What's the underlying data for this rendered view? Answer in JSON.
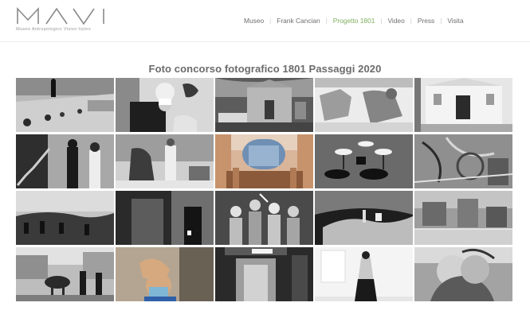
{
  "logo": {
    "brand": "MAVI",
    "subtitle": "Museo Antropologico Visivo Irpino"
  },
  "nav": {
    "items": [
      {
        "label": "Museo",
        "active": false
      },
      {
        "label": "Frank Cancian",
        "active": false
      },
      {
        "label": "Progetto 1801",
        "active": true
      },
      {
        "label": "Video",
        "active": false
      },
      {
        "label": "Press",
        "active": false
      },
      {
        "label": "Visita",
        "active": false
      }
    ],
    "separator": "|",
    "active_color": "#7fae5e"
  },
  "page": {
    "title": "Foto concorso fotografico 1801 Passaggi 2020"
  },
  "gallery": {
    "rows": 4,
    "columns": 5,
    "photos": [
      {
        "name": "photo-street-steps-figure",
        "tone": "bw"
      },
      {
        "name": "photo-masked-woman-doorway",
        "tone": "bw"
      },
      {
        "name": "photo-church-facade-car",
        "tone": "bw"
      },
      {
        "name": "photo-shirt-on-table",
        "tone": "bw"
      },
      {
        "name": "photo-white-church-facade",
        "tone": "bw"
      },
      {
        "name": "photo-staircase-women",
        "tone": "bw"
      },
      {
        "name": "photo-women-in-courtyard",
        "tone": "bw"
      },
      {
        "name": "photo-church-altar-painting",
        "tone": "color"
      },
      {
        "name": "photo-cafe-tables-shadows",
        "tone": "bw"
      },
      {
        "name": "photo-graffiti-reflection",
        "tone": "bw"
      },
      {
        "name": "photo-hilltop-crowd",
        "tone": "bw"
      },
      {
        "name": "photo-dark-doorway",
        "tone": "bw"
      },
      {
        "name": "photo-group-celebration",
        "tone": "bw"
      },
      {
        "name": "photo-hillside-town-sky",
        "tone": "bw"
      },
      {
        "name": "photo-city-reflection",
        "tone": "bw"
      },
      {
        "name": "photo-horse-cart-street",
        "tone": "bw"
      },
      {
        "name": "photo-man-with-mask",
        "tone": "color"
      },
      {
        "name": "photo-archway-street",
        "tone": "bw"
      },
      {
        "name": "photo-woman-back-gallery",
        "tone": "bw"
      },
      {
        "name": "photo-couple-embrace",
        "tone": "bw"
      }
    ]
  }
}
